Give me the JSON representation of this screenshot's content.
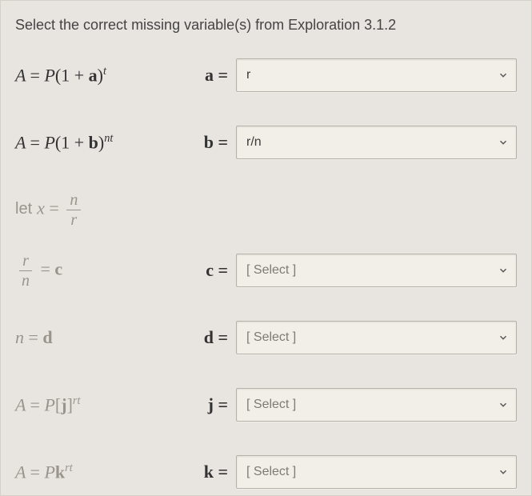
{
  "prompt": "Select the correct missing variable(s) from Exploration 3.1.2",
  "rows": [
    {
      "var": "a",
      "eq_sign": "=",
      "selected": "r",
      "placeholder": false
    },
    {
      "var": "b",
      "eq_sign": "=",
      "selected": "r/n",
      "placeholder": false
    },
    {
      "var": "c",
      "eq_sign": "=",
      "selected": "[ Select ]",
      "placeholder": true
    },
    {
      "var": "d",
      "eq_sign": "=",
      "selected": "[ Select ]",
      "placeholder": true
    },
    {
      "var": "j",
      "eq_sign": "=",
      "selected": "[ Select ]",
      "placeholder": true
    },
    {
      "var": "k",
      "eq_sign": "=",
      "selected": "[ Select ]",
      "placeholder": true
    }
  ],
  "equations": {
    "a": {
      "A": "A",
      "eq": "=",
      "P": "P",
      "open": "(1 + ",
      "bold": "a",
      "close": ")",
      "sup": "t"
    },
    "b": {
      "A": "A",
      "eq": "=",
      "P": "P",
      "open": "(1 + ",
      "bold": "b",
      "close": ")",
      "sup": "nt"
    },
    "let": {
      "let": "let",
      "x": "x",
      "eq": "=",
      "num": "n",
      "den": "r"
    },
    "c": {
      "num": "r",
      "den": "n",
      "eq": "=",
      "bold": "c"
    },
    "d": {
      "n": "n",
      "eq": "=",
      "bold": "d"
    },
    "j": {
      "A": "A",
      "eq": "=",
      "P": "P",
      "open": "[",
      "bold": "j",
      "close": "]",
      "sup": "rt"
    },
    "k": {
      "A": "A",
      "eq": "=",
      "P": "P",
      "bold": "k",
      "sup": "rt"
    }
  }
}
